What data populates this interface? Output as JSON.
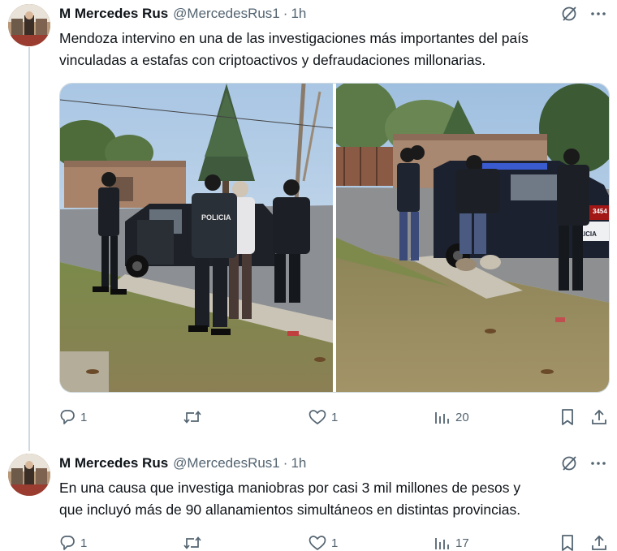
{
  "tweets": [
    {
      "author_name": "M Mercedes Rus",
      "handle": "@MercedesRus1",
      "separator": "·",
      "time": "1h",
      "text_lines": [
        "Mendoza intervino en una de las investigaciones más importantes del país",
        "vinculadas a estafas con criptoactivos y defraudaciones millonarias."
      ],
      "photo_left_label": "POLICIA",
      "photo_right_labels": [
        "3454",
        "LICIA"
      ],
      "replies": "1",
      "retweets": "",
      "likes": "1",
      "views": "20"
    },
    {
      "author_name": "M Mercedes Rus",
      "handle": "@MercedesRus1",
      "separator": "·",
      "time": "1h",
      "text_lines": [
        "En una causa que investiga maniobras por casi 3 mil millones de pesos y",
        "que incluyó más de 90 allanamientos simultáneos en distintas provincias."
      ],
      "replies": "1",
      "retweets": "",
      "likes": "1",
      "views": "17"
    }
  ],
  "icons": {
    "grok": "grok-icon",
    "more": "more-icon",
    "reply": "reply-icon",
    "retweet": "retweet-icon",
    "like": "like-icon",
    "views": "views-icon",
    "bookmark": "bookmark-icon",
    "share": "share-icon"
  },
  "colors": {
    "text": "#0f1419",
    "secondary": "#536471",
    "border": "#cfd9de"
  }
}
